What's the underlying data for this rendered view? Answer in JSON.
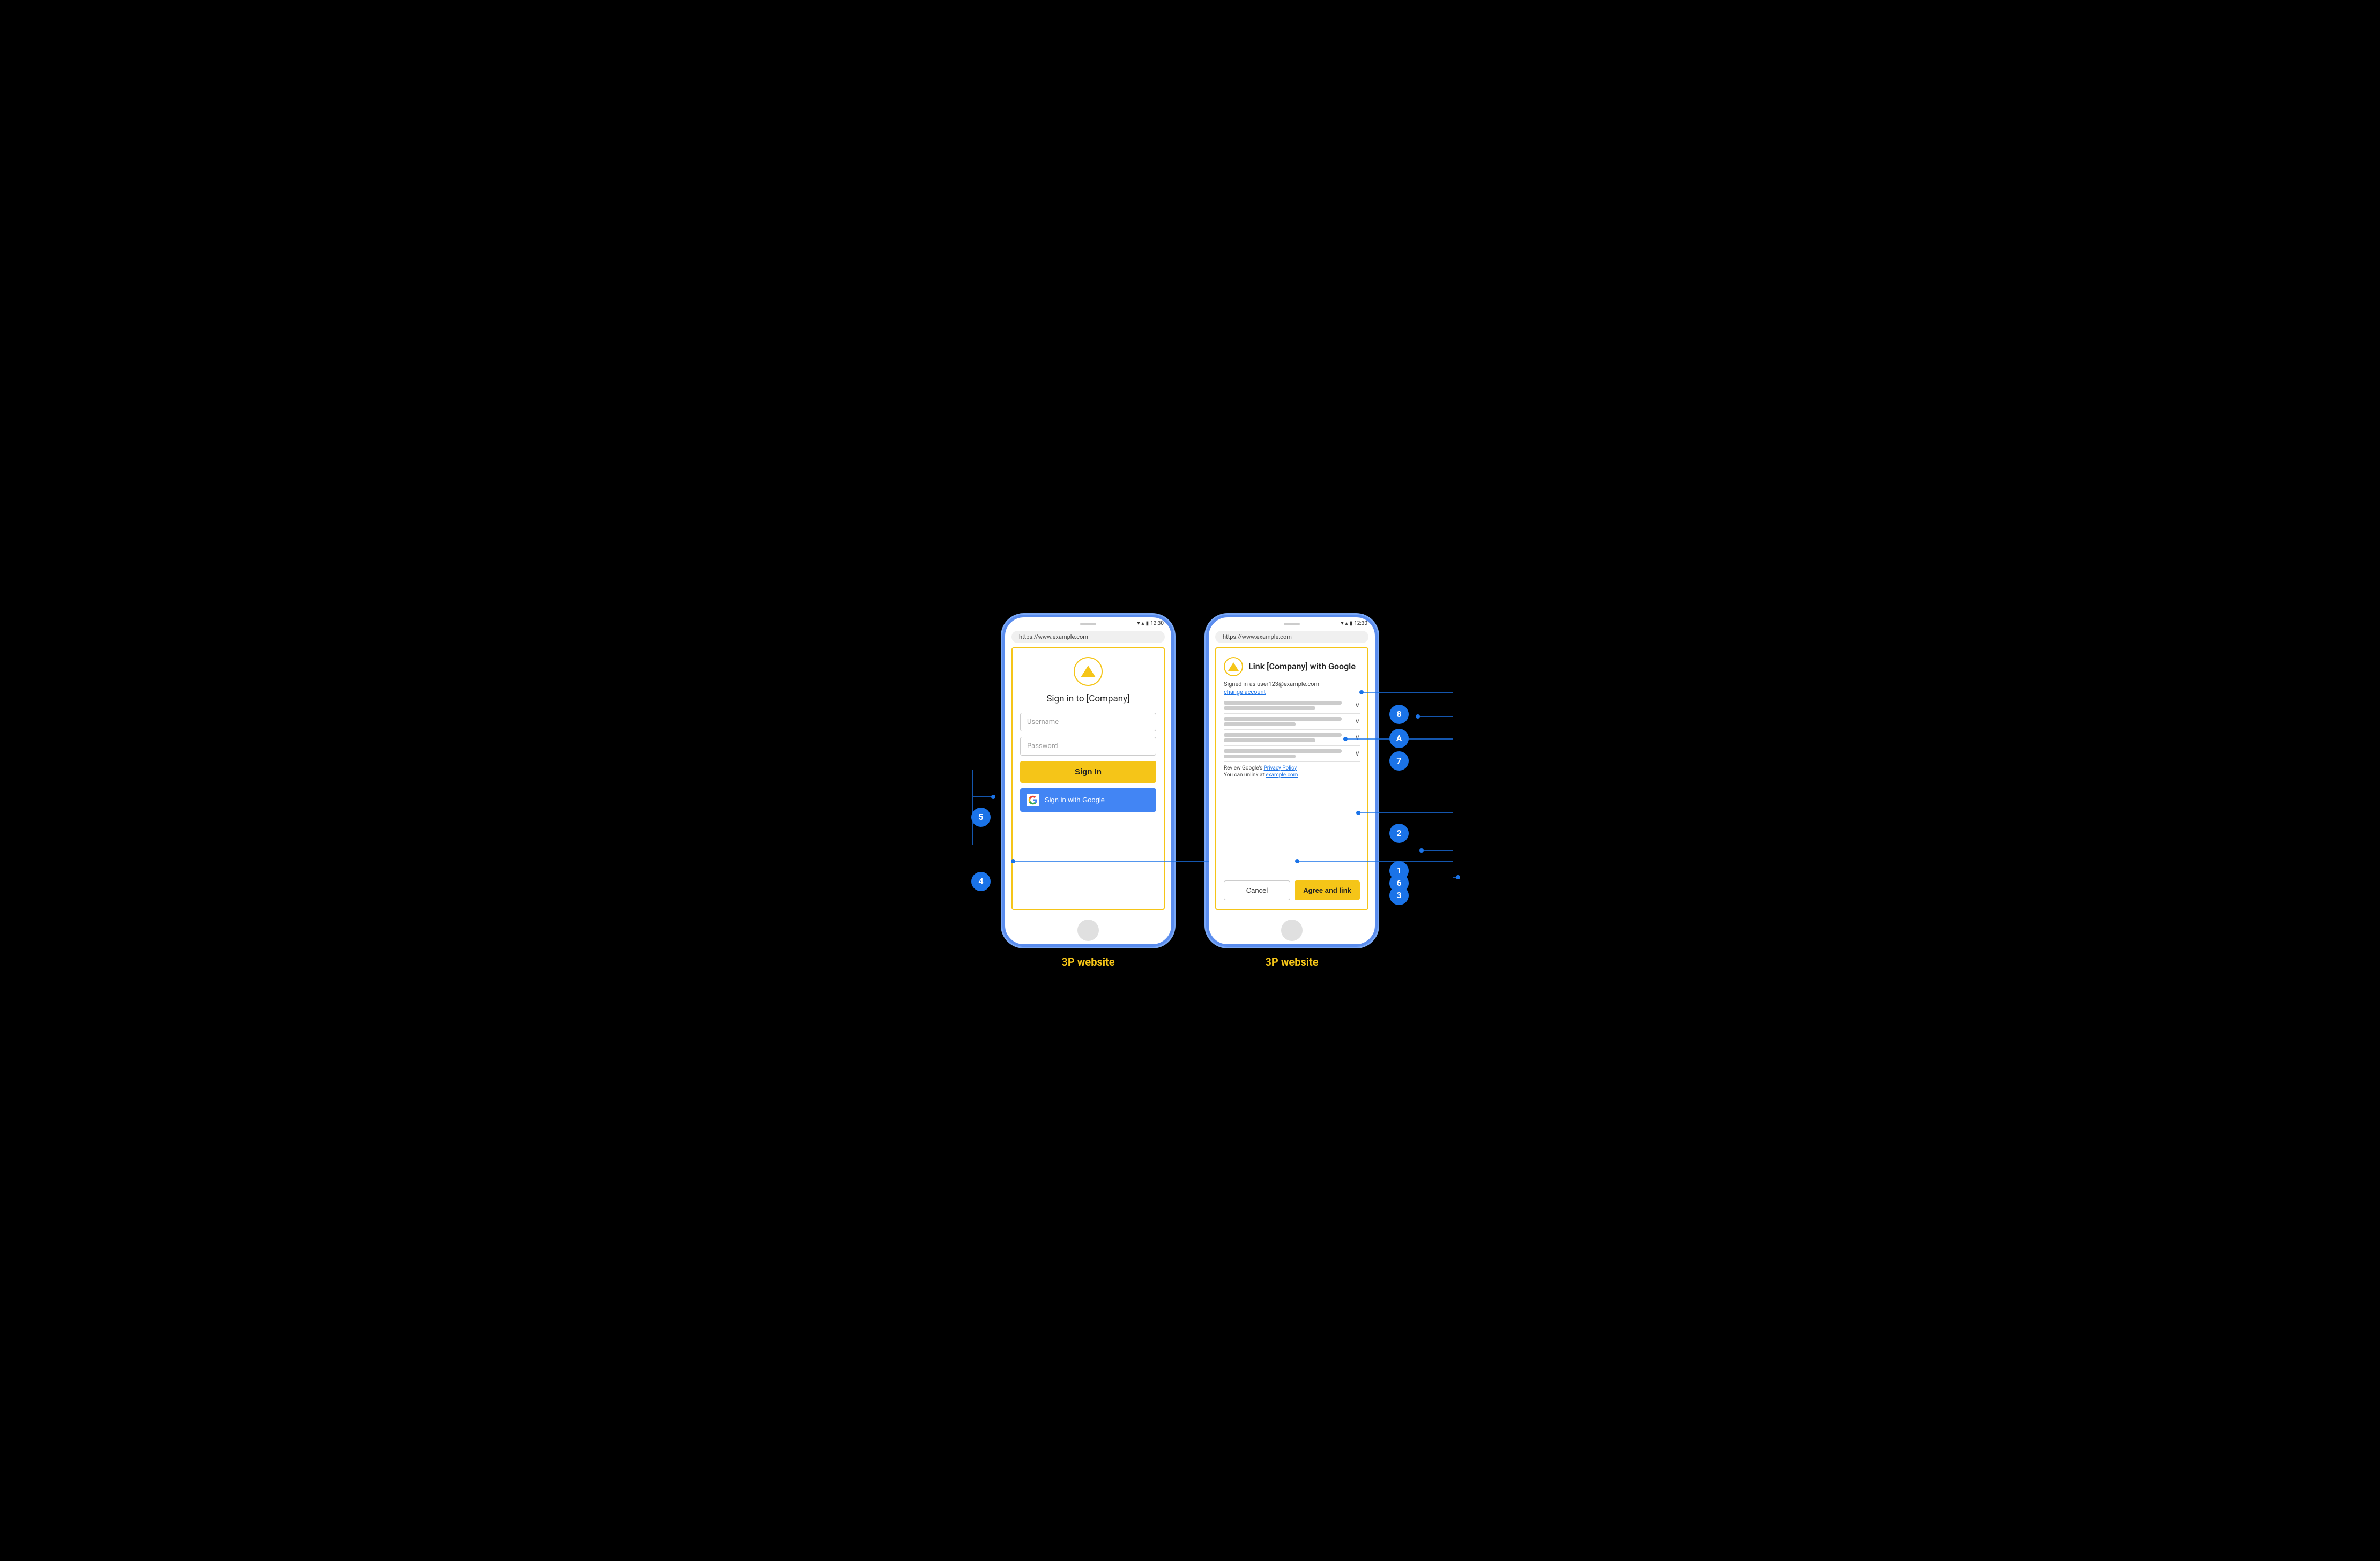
{
  "diagram": {
    "bg": "#000000"
  },
  "left_phone": {
    "status": {
      "time": "12:30",
      "signal": "▼◀",
      "battery": "▮"
    },
    "url": "https://www.example.com",
    "title": "Sign in to [Company]",
    "username_placeholder": "Username",
    "password_placeholder": "Password",
    "sign_in_btn": "Sign In",
    "google_btn": "Sign in with Google",
    "label": "3P website",
    "callout_5": "5",
    "callout_4": "4"
  },
  "right_phone": {
    "status": {
      "time": "12:30"
    },
    "url": "https://www.example.com",
    "link_title": "Link [Company] with Google",
    "signed_in_as": "Signed in as user123@example.com",
    "change_account": "change account",
    "policy_text": "Review Google's",
    "policy_link": "Privacy Policy",
    "unlink_text": "You can unlink at",
    "unlink_link": "example.com",
    "cancel_btn": "Cancel",
    "agree_btn": "Agree and link",
    "label": "3P website",
    "callout_8": "8",
    "callout_A": "A",
    "callout_7": "7",
    "callout_2": "2",
    "callout_1": "1",
    "callout_6": "6",
    "callout_3": "3"
  }
}
